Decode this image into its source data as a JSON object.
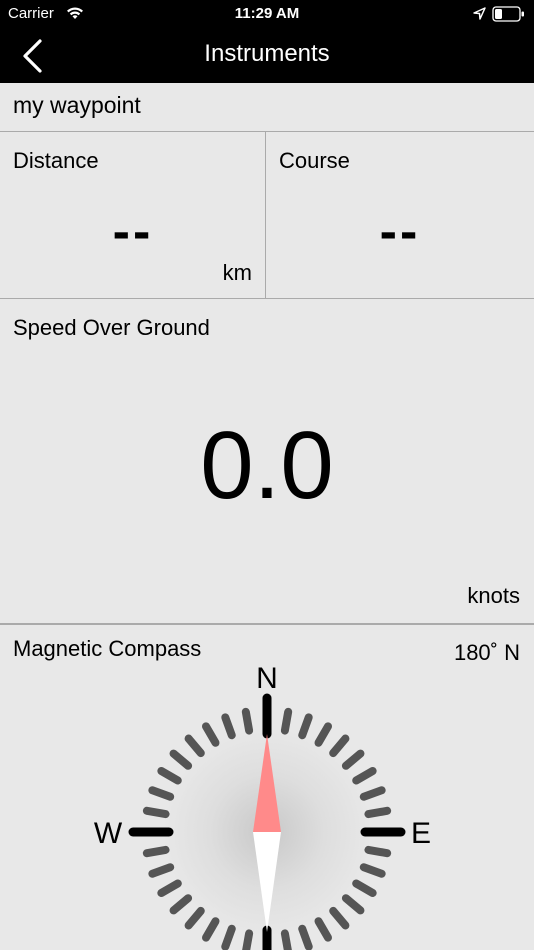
{
  "status_bar": {
    "carrier": "Carrier",
    "time": "11:29 AM",
    "icons": [
      "wifi-icon",
      "location-arrow-icon",
      "battery-icon"
    ]
  },
  "nav": {
    "title": "Instruments",
    "back_icon": "chevron-left-icon"
  },
  "waypoint": {
    "name": "my waypoint"
  },
  "distance": {
    "label": "Distance",
    "value": "--",
    "unit": "km"
  },
  "course": {
    "label": "Course",
    "value": "--"
  },
  "speed": {
    "label": "Speed Over Ground",
    "value": "0.0",
    "unit": "knots"
  },
  "compass": {
    "label": "Magnetic Compass",
    "heading": "180˚ N",
    "directions": {
      "north": "N",
      "west": "W",
      "east": "E"
    },
    "needle_colors": {
      "north": "#ff8a8a",
      "south": "#ffffff"
    }
  }
}
